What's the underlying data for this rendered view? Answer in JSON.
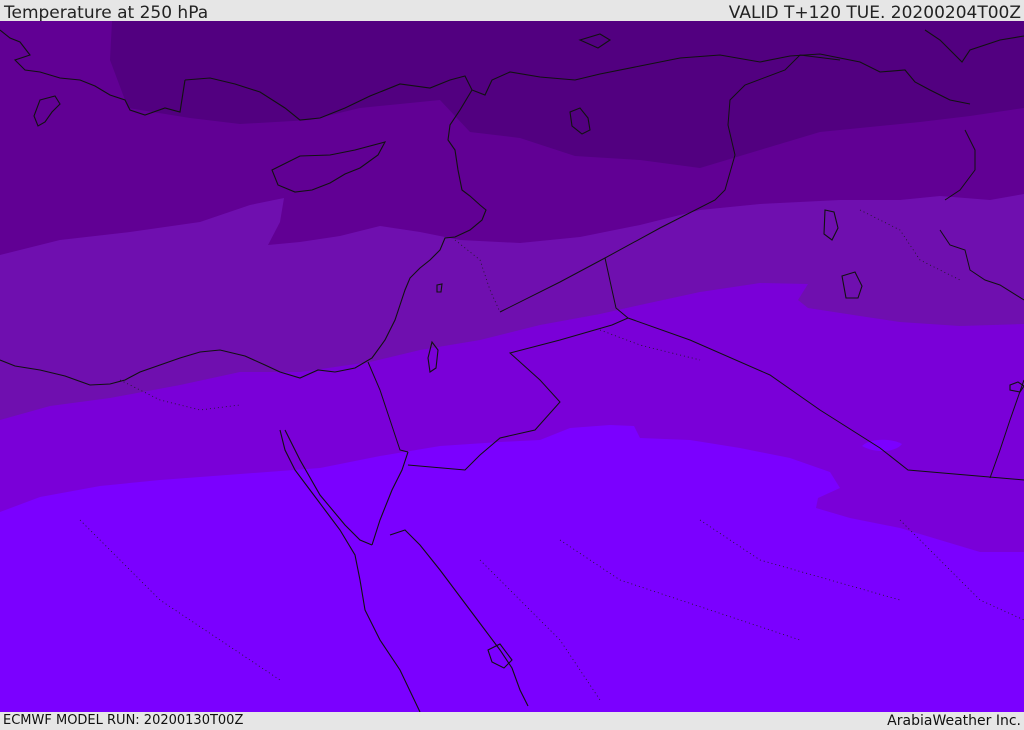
{
  "header": {
    "title": "Temperature at 250 hPa",
    "valid": "VALID T+120 TUE. 20200204T00Z"
  },
  "footer": {
    "model_run": "ECMWF MODEL RUN: 20200130T00Z",
    "brand": "ArabiaWeather Inc."
  },
  "colors": {
    "band_coldest": "#520080",
    "band_2": "#610094",
    "band_3": "#6f0faf",
    "band_4": "#7a00d8",
    "band_warmest": "#7b00ff",
    "coast_line": "#111111"
  }
}
